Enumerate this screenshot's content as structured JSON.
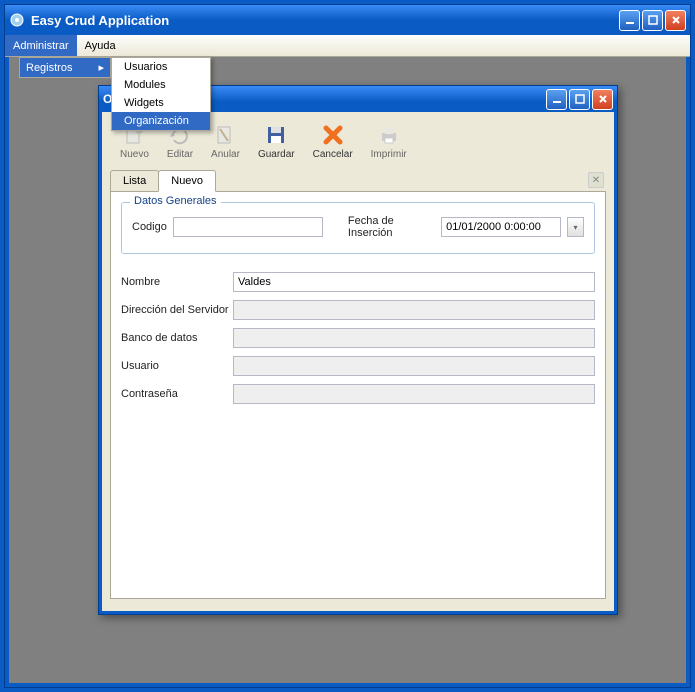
{
  "app": {
    "title": "Easy Crud Application"
  },
  "menubar": {
    "administrar": "Administrar",
    "ayuda": "Ayuda"
  },
  "dropdown": {
    "parent": "Registros",
    "items": {
      "usuarios": "Usuarios",
      "modules": "Modules",
      "widgets": "Widgets",
      "organizacion": "Organización"
    }
  },
  "child": {
    "title": "Organización",
    "toolbar": {
      "nuevo": "Nuevo",
      "editar": "Editar",
      "anular": "Anular",
      "guardar": "Guardar",
      "cancelar": "Cancelar",
      "imprimir": "Imprimir"
    },
    "tabs": {
      "lista": "Lista",
      "nuevo": "Nuevo"
    },
    "fieldset": {
      "legend": "Datos Generales",
      "codigo_label": "Codigo",
      "codigo_value": "",
      "fecha_label": "Fecha de Inserción",
      "fecha_value": "01/01/2000 0:00:00"
    },
    "form": {
      "nombre_label": "Nombre",
      "nombre_value": "Valdes",
      "direccion_label": "Dirección del Servidor",
      "direccion_value": "",
      "banco_label": "Banco de datos",
      "banco_value": "",
      "usuario_label": "Usuario",
      "usuario_value": "",
      "contrasena_label": "Contraseña",
      "contrasena_value": ""
    }
  }
}
